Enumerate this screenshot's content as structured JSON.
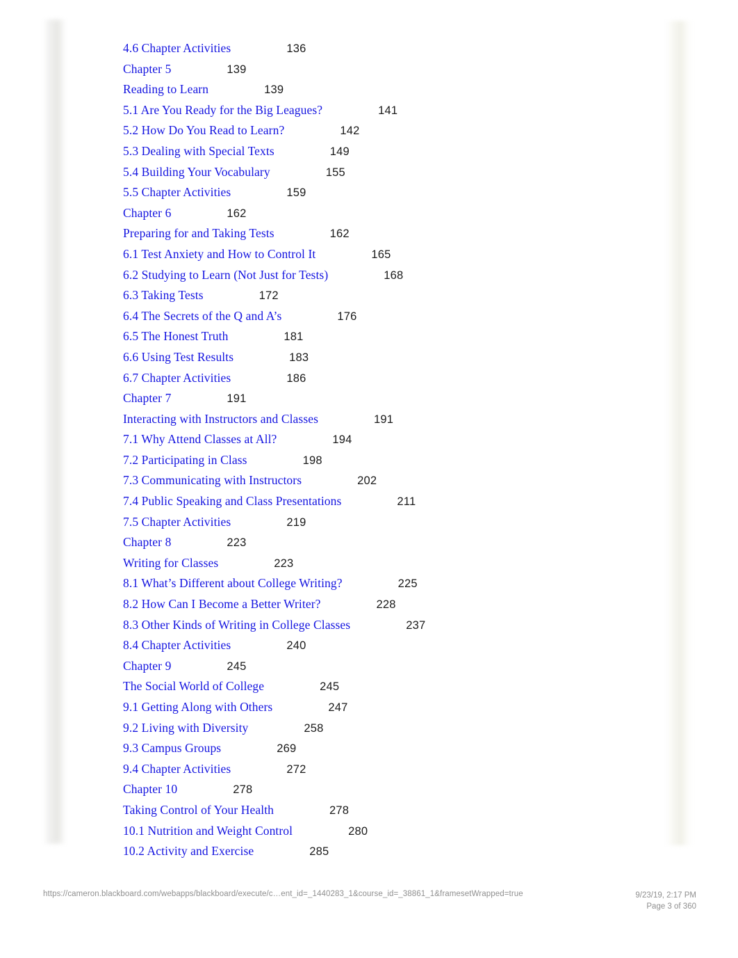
{
  "document": {
    "kind": "table-of-contents",
    "link_color": "#1414e0",
    "page_number_color": "#1a1a1a",
    "footer_color": "#8f8f8f",
    "background_color": "#ffffff"
  },
  "toc": {
    "entries": [
      {
        "title": "4.6 Chapter Activities",
        "page": "136"
      },
      {
        "title": "Chapter 5",
        "page": "139"
      },
      {
        "title": "Reading to Learn",
        "page": "139"
      },
      {
        "title": "5.1 Are You Ready for the Big Leagues?",
        "page": "141"
      },
      {
        "title": "5.2 How Do You Read to Learn?",
        "page": "142"
      },
      {
        "title": "5.3 Dealing with Special Texts",
        "page": "149"
      },
      {
        "title": "5.4 Building Your Vocabulary",
        "page": "155"
      },
      {
        "title": "5.5 Chapter Activities",
        "page": "159"
      },
      {
        "title": "Chapter 6",
        "page": "162"
      },
      {
        "title": "Preparing for and Taking Tests",
        "page": "162"
      },
      {
        "title": "6.1 Test Anxiety and How to Control It",
        "page": "165"
      },
      {
        "title": "6.2 Studying to Learn (Not Just for Tests)",
        "page": "168"
      },
      {
        "title": "6.3 Taking Tests",
        "page": "172"
      },
      {
        "title": "6.4 The Secrets of the Q and A’s",
        "page": "176"
      },
      {
        "title": "6.5 The Honest Truth",
        "page": "181"
      },
      {
        "title": "6.6 Using Test Results",
        "page": "183"
      },
      {
        "title": "6.7 Chapter Activities",
        "page": "186"
      },
      {
        "title": "Chapter 7",
        "page": "191"
      },
      {
        "title": "Interacting with Instructors and Classes",
        "page": "191"
      },
      {
        "title": "7.1 Why Attend Classes at All?",
        "page": "194"
      },
      {
        "title": "7.2 Participating in Class",
        "page": "198"
      },
      {
        "title": "7.3 Communicating with Instructors",
        "page": "202"
      },
      {
        "title": "7.4 Public Speaking and Class Presentations",
        "page": "211"
      },
      {
        "title": "7.5 Chapter Activities",
        "page": "219"
      },
      {
        "title": "Chapter 8",
        "page": "223"
      },
      {
        "title": "Writing for Classes",
        "page": "223"
      },
      {
        "title": "8.1 What’s Different about College Writing?",
        "page": "225"
      },
      {
        "title": "8.2 How Can I Become a Better Writer?",
        "page": "228"
      },
      {
        "title": "8.3 Other Kinds of Writing in College Classes",
        "page": "237"
      },
      {
        "title": "8.4 Chapter Activities",
        "page": "240"
      },
      {
        "title": "Chapter 9",
        "page": "245"
      },
      {
        "title": "The Social World of College",
        "page": "245"
      },
      {
        "title": "9.1 Getting Along with Others",
        "page": "247"
      },
      {
        "title": "9.2 Living with Diversity",
        "page": "258"
      },
      {
        "title": "9.3 Campus Groups",
        "page": "269"
      },
      {
        "title": "9.4 Chapter Activities",
        "page": "272"
      },
      {
        "title": "Chapter 10",
        "page": "278"
      },
      {
        "title": "Taking Control of Your Health",
        "page": "278"
      },
      {
        "title": "10.1 Nutrition and Weight Control",
        "page": "280"
      },
      {
        "title": "10.2 Activity and Exercise",
        "page": "285"
      }
    ]
  },
  "footer": {
    "url": "https://cameron.blackboard.com/webapps/blackboard/execute/c…ent_id=_1440283_1&course_id=_38861_1&framesetWrapped=true",
    "timestamp": "9/23/19, 2:17 PM",
    "page_indicator": "Page 3 of 360"
  }
}
